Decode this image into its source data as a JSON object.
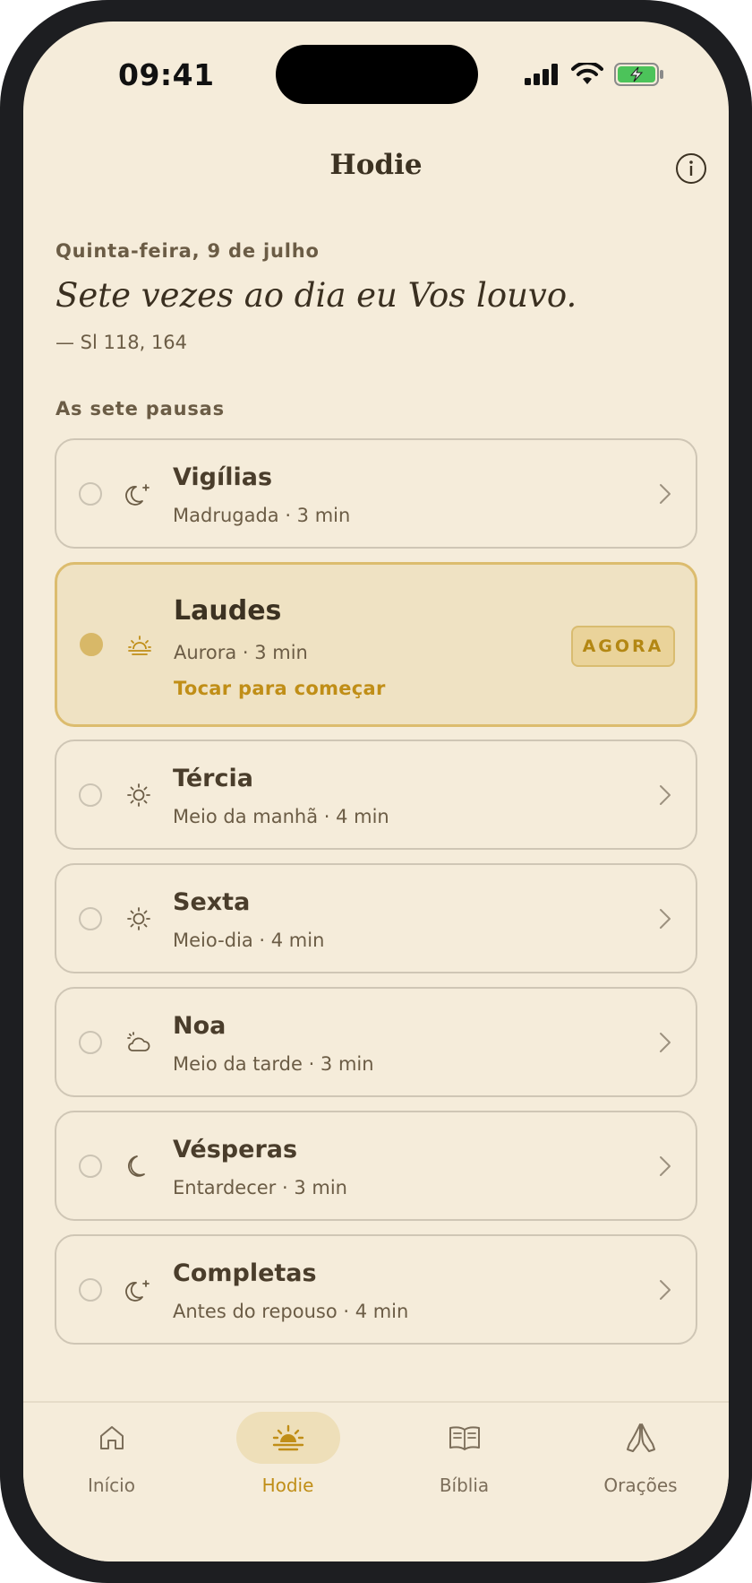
{
  "status_bar": {
    "time": "09:41"
  },
  "header": {
    "title": "Hodie"
  },
  "today": {
    "date": "Quinta-feira, 9 de julho",
    "verse": "Sete vezes ao dia eu Vos louvo.",
    "reference": "— Sl 118, 164"
  },
  "section_label": "As sete pausas",
  "pauses": [
    {
      "name": "Vigílias",
      "detail": "Madrugada · 3 min",
      "icon": "moon-star-icon"
    },
    {
      "name": "Laudes",
      "detail": "Aurora · 3 min",
      "icon": "sunrise-icon",
      "badge": "AGORA",
      "cta": "Tocar para começar"
    },
    {
      "name": "Tércia",
      "detail": "Meio da manhã · 4 min",
      "icon": "sun-icon"
    },
    {
      "name": "Sexta",
      "detail": "Meio-dia · 4 min",
      "icon": "sun-icon"
    },
    {
      "name": "Noa",
      "detail": "Meio da tarde · 3 min",
      "icon": "cloud-sun-icon"
    },
    {
      "name": "Vésperas",
      "detail": "Entardecer · 3 min",
      "icon": "moon-icon"
    },
    {
      "name": "Completas",
      "detail": "Antes do repouso · 4 min",
      "icon": "moon-star-icon"
    }
  ],
  "tabs": [
    {
      "label": "Início",
      "icon": "home-icon"
    },
    {
      "label": "Hodie",
      "icon": "sunrise-icon"
    },
    {
      "label": "Bíblia",
      "icon": "book-icon"
    },
    {
      "label": "Orações",
      "icon": "praying-hands-icon"
    }
  ],
  "colors": {
    "background": "#f5ecda",
    "accent": "#c08e17",
    "active_card": "#efe2c3",
    "text_primary": "#3c3222",
    "text_secondary": "#6b5c45"
  }
}
